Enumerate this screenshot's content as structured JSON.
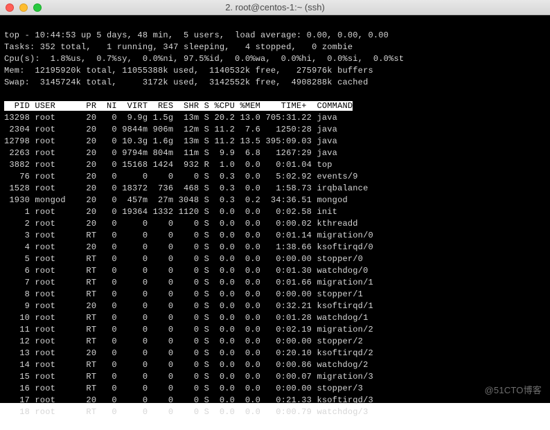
{
  "window": {
    "title": "2. root@centos-1:~ (ssh)"
  },
  "top_header": {
    "line1": "top - 10:44:53 up 5 days, 48 min,  5 users,  load average: 0.00, 0.00, 0.00",
    "line2": "Tasks: 352 total,   1 running, 347 sleeping,   4 stopped,   0 zombie",
    "line3": "Cpu(s):  1.8%us,  0.7%sy,  0.0%ni, 97.5%id,  0.0%wa,  0.0%hi,  0.0%si,  0.0%st",
    "line4": "Mem:  12195920k total, 11055388k used,  1140532k free,   275976k buffers",
    "line5": "Swap:  3145724k total,     3172k used,  3142552k free,  4908288k cached"
  },
  "columns": "  PID USER      PR  NI  VIRT  RES  SHR S %CPU %MEM    TIME+  COMMAND",
  "processes": [
    {
      "pid": "13298",
      "user": "root",
      "pr": "20",
      "ni": "0",
      "virt": "9.9g",
      "res": "1.5g",
      "shr": "13m",
      "s": "S",
      "cpu": "20.2",
      "mem": "13.0",
      "time": "705:31.22",
      "cmd": "java"
    },
    {
      "pid": "2304",
      "user": "root",
      "pr": "20",
      "ni": "0",
      "virt": "9844m",
      "res": "906m",
      "shr": "12m",
      "s": "S",
      "cpu": "11.2",
      "mem": "7.6",
      "time": "1250:28",
      "cmd": "java"
    },
    {
      "pid": "12798",
      "user": "root",
      "pr": "20",
      "ni": "0",
      "virt": "10.3g",
      "res": "1.6g",
      "shr": "13m",
      "s": "S",
      "cpu": "11.2",
      "mem": "13.5",
      "time": "395:09.03",
      "cmd": "java"
    },
    {
      "pid": "2263",
      "user": "root",
      "pr": "20",
      "ni": "0",
      "virt": "9794m",
      "res": "804m",
      "shr": "11m",
      "s": "S",
      "cpu": "9.9",
      "mem": "6.8",
      "time": "1267:29",
      "cmd": "java"
    },
    {
      "pid": "3882",
      "user": "root",
      "pr": "20",
      "ni": "0",
      "virt": "15168",
      "res": "1424",
      "shr": "932",
      "s": "R",
      "cpu": "1.0",
      "mem": "0.0",
      "time": "0:01.04",
      "cmd": "top"
    },
    {
      "pid": "76",
      "user": "root",
      "pr": "20",
      "ni": "0",
      "virt": "0",
      "res": "0",
      "shr": "0",
      "s": "S",
      "cpu": "0.3",
      "mem": "0.0",
      "time": "5:02.92",
      "cmd": "events/9"
    },
    {
      "pid": "1528",
      "user": "root",
      "pr": "20",
      "ni": "0",
      "virt": "18372",
      "res": "736",
      "shr": "468",
      "s": "S",
      "cpu": "0.3",
      "mem": "0.0",
      "time": "1:58.73",
      "cmd": "irqbalance"
    },
    {
      "pid": "1930",
      "user": "mongod",
      "pr": "20",
      "ni": "0",
      "virt": "457m",
      "res": "27m",
      "shr": "3048",
      "s": "S",
      "cpu": "0.3",
      "mem": "0.2",
      "time": "34:36.51",
      "cmd": "mongod"
    },
    {
      "pid": "1",
      "user": "root",
      "pr": "20",
      "ni": "0",
      "virt": "19364",
      "res": "1332",
      "shr": "1120",
      "s": "S",
      "cpu": "0.0",
      "mem": "0.0",
      "time": "0:02.58",
      "cmd": "init"
    },
    {
      "pid": "2",
      "user": "root",
      "pr": "20",
      "ni": "0",
      "virt": "0",
      "res": "0",
      "shr": "0",
      "s": "S",
      "cpu": "0.0",
      "mem": "0.0",
      "time": "0:00.02",
      "cmd": "kthreadd"
    },
    {
      "pid": "3",
      "user": "root",
      "pr": "RT",
      "ni": "0",
      "virt": "0",
      "res": "0",
      "shr": "0",
      "s": "S",
      "cpu": "0.0",
      "mem": "0.0",
      "time": "0:01.14",
      "cmd": "migration/0"
    },
    {
      "pid": "4",
      "user": "root",
      "pr": "20",
      "ni": "0",
      "virt": "0",
      "res": "0",
      "shr": "0",
      "s": "S",
      "cpu": "0.0",
      "mem": "0.0",
      "time": "1:38.66",
      "cmd": "ksoftirqd/0"
    },
    {
      "pid": "5",
      "user": "root",
      "pr": "RT",
      "ni": "0",
      "virt": "0",
      "res": "0",
      "shr": "0",
      "s": "S",
      "cpu": "0.0",
      "mem": "0.0",
      "time": "0:00.00",
      "cmd": "stopper/0"
    },
    {
      "pid": "6",
      "user": "root",
      "pr": "RT",
      "ni": "0",
      "virt": "0",
      "res": "0",
      "shr": "0",
      "s": "S",
      "cpu": "0.0",
      "mem": "0.0",
      "time": "0:01.30",
      "cmd": "watchdog/0"
    },
    {
      "pid": "7",
      "user": "root",
      "pr": "RT",
      "ni": "0",
      "virt": "0",
      "res": "0",
      "shr": "0",
      "s": "S",
      "cpu": "0.0",
      "mem": "0.0",
      "time": "0:01.66",
      "cmd": "migration/1"
    },
    {
      "pid": "8",
      "user": "root",
      "pr": "RT",
      "ni": "0",
      "virt": "0",
      "res": "0",
      "shr": "0",
      "s": "S",
      "cpu": "0.0",
      "mem": "0.0",
      "time": "0:00.00",
      "cmd": "stopper/1"
    },
    {
      "pid": "9",
      "user": "root",
      "pr": "20",
      "ni": "0",
      "virt": "0",
      "res": "0",
      "shr": "0",
      "s": "S",
      "cpu": "0.0",
      "mem": "0.0",
      "time": "0:32.21",
      "cmd": "ksoftirqd/1"
    },
    {
      "pid": "10",
      "user": "root",
      "pr": "RT",
      "ni": "0",
      "virt": "0",
      "res": "0",
      "shr": "0",
      "s": "S",
      "cpu": "0.0",
      "mem": "0.0",
      "time": "0:01.28",
      "cmd": "watchdog/1"
    },
    {
      "pid": "11",
      "user": "root",
      "pr": "RT",
      "ni": "0",
      "virt": "0",
      "res": "0",
      "shr": "0",
      "s": "S",
      "cpu": "0.0",
      "mem": "0.0",
      "time": "0:02.19",
      "cmd": "migration/2"
    },
    {
      "pid": "12",
      "user": "root",
      "pr": "RT",
      "ni": "0",
      "virt": "0",
      "res": "0",
      "shr": "0",
      "s": "S",
      "cpu": "0.0",
      "mem": "0.0",
      "time": "0:00.00",
      "cmd": "stopper/2"
    },
    {
      "pid": "13",
      "user": "root",
      "pr": "20",
      "ni": "0",
      "virt": "0",
      "res": "0",
      "shr": "0",
      "s": "S",
      "cpu": "0.0",
      "mem": "0.0",
      "time": "0:20.10",
      "cmd": "ksoftirqd/2"
    },
    {
      "pid": "14",
      "user": "root",
      "pr": "RT",
      "ni": "0",
      "virt": "0",
      "res": "0",
      "shr": "0",
      "s": "S",
      "cpu": "0.0",
      "mem": "0.0",
      "time": "0:00.86",
      "cmd": "watchdog/2"
    },
    {
      "pid": "15",
      "user": "root",
      "pr": "RT",
      "ni": "0",
      "virt": "0",
      "res": "0",
      "shr": "0",
      "s": "S",
      "cpu": "0.0",
      "mem": "0.0",
      "time": "0:00.07",
      "cmd": "migration/3"
    },
    {
      "pid": "16",
      "user": "root",
      "pr": "RT",
      "ni": "0",
      "virt": "0",
      "res": "0",
      "shr": "0",
      "s": "S",
      "cpu": "0.0",
      "mem": "0.0",
      "time": "0:00.00",
      "cmd": "stopper/3"
    },
    {
      "pid": "17",
      "user": "root",
      "pr": "20",
      "ni": "0",
      "virt": "0",
      "res": "0",
      "shr": "0",
      "s": "S",
      "cpu": "0.0",
      "mem": "0.0",
      "time": "0:21.33",
      "cmd": "ksoftirqd/3"
    },
    {
      "pid": "18",
      "user": "root",
      "pr": "RT",
      "ni": "0",
      "virt": "0",
      "res": "0",
      "shr": "0",
      "s": "S",
      "cpu": "0.0",
      "mem": "0.0",
      "time": "0:00.79",
      "cmd": "watchdog/3"
    }
  ],
  "watermark": "@51CTO博客"
}
